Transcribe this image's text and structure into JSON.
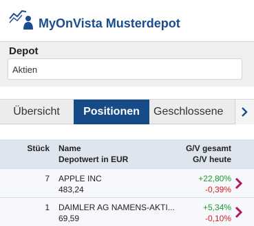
{
  "app": {
    "title": "MyOnVista Musterdepot"
  },
  "depot": {
    "label": "Depot",
    "selected": "Aktien"
  },
  "tabs": [
    {
      "label": "Übersicht",
      "active": false
    },
    {
      "label": "Positionen",
      "active": true
    },
    {
      "label": "Geschlossene",
      "active": false
    }
  ],
  "columns": {
    "qty": "Stück",
    "name": "Name",
    "value": "Depotwert in EUR",
    "gv_total": "G/V gesamt",
    "gv_today": "G/V heute"
  },
  "positions": [
    {
      "qty": "7",
      "name": "APPLE INC",
      "value": "483,24",
      "gv_total": "+22,80%",
      "gv_today": "-0,39%"
    },
    {
      "qty": "1",
      "name": "DAIMLER AG NAMENS-AKTI...",
      "value": "69,59",
      "gv_total": "+5,34%",
      "gv_today": "-0,10%"
    }
  ],
  "colors": {
    "brand": "#1a4d8f",
    "tab_active": "#174b88",
    "positive": "#1a9a2e",
    "negative": "#d21f1f",
    "chevron": "#b0155d"
  },
  "icons": {
    "logo": "chart-user-icon",
    "tab_next": "chevron-right-icon",
    "row_detail": "chevron-right-icon"
  }
}
